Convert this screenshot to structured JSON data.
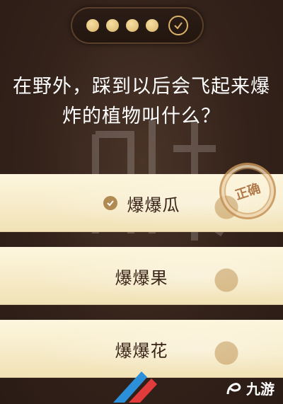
{
  "progress": {
    "completed_dots": 4,
    "current": "check"
  },
  "question": {
    "line1": "在野外，踩到以后会飞起来爆",
    "line2": "炸的植物叫什么？"
  },
  "answers": [
    {
      "label": "爆爆瓜",
      "selected": true
    },
    {
      "label": "爆爆果",
      "selected": false
    },
    {
      "label": "爆爆花",
      "selected": false
    }
  ],
  "stamp": {
    "text": "正确"
  },
  "logo": {
    "text": "九游"
  },
  "colors": {
    "accent": "#d9b36a",
    "background": "#33221a",
    "answer_bg": "#f6ecc8",
    "text_dark": "#3a2418"
  }
}
